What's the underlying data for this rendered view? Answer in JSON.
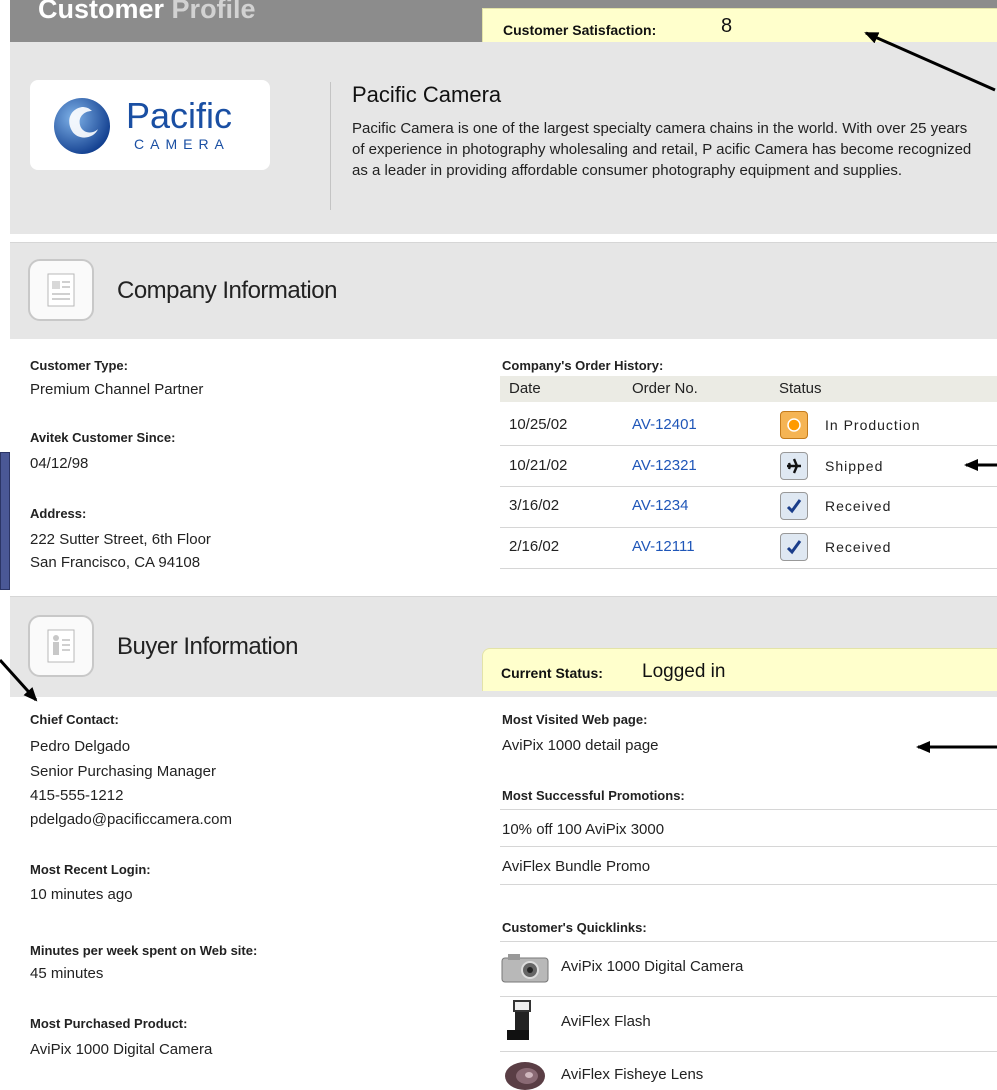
{
  "header": {
    "title_part1": "Customer",
    "title_part2": "Profile",
    "satisfaction_label": "Customer Satisfaction:",
    "satisfaction_value": "8"
  },
  "profile": {
    "logo_name": "Pacific",
    "logo_sub": "CAMERA",
    "company_name": "Pacific Camera",
    "description": "Pacific Camera is one of the largest specialty camera chains in the world. With over 25 years of experience in photography wholesaling and retail, P acific Camera has become recognized as a leader in providing affordable consumer photography equipment and supplies."
  },
  "company_section": {
    "title": "Company Information",
    "customer_type_label": "Customer Type:",
    "customer_type": "Premium Channel Partner",
    "since_label": "Avitek Customer Since:",
    "since": "04/12/98",
    "address_label": "Address:",
    "address_line1": "222 Sutter Street, 6th Floor",
    "address_line2": "San Francisco, CA  94108"
  },
  "order_history": {
    "title": "Company's Order History:",
    "headers": {
      "date": "Date",
      "order_no": "Order No.",
      "status": "Status"
    },
    "rows": [
      {
        "date": "10/25/02",
        "order_no": "AV-12401",
        "status": "In Production",
        "icon": "in-production-icon"
      },
      {
        "date": "10/21/02",
        "order_no": "AV-12321",
        "status": "Shipped",
        "icon": "airplane-icon"
      },
      {
        "date": "3/16/02",
        "order_no": "AV-1234",
        "status": "Received",
        "icon": "checkmark-icon"
      },
      {
        "date": "2/16/02",
        "order_no": "AV-12111",
        "status": "Received",
        "icon": "checkmark-icon"
      }
    ]
  },
  "buyer_section": {
    "title": "Buyer Information",
    "current_status_label": "Current Status:",
    "current_status": "Logged in",
    "chief_contact_label": "Chief Contact:",
    "contact_name": "Pedro Delgado",
    "contact_title": "Senior Purchasing Manager",
    "contact_phone": "415-555-1212",
    "contact_email": "pdelgado@pacificcamera.com",
    "recent_login_label": "Most Recent Login:",
    "recent_login": "10 minutes ago",
    "minutes_label": "Minutes per week spent on Web site:",
    "minutes": "45 minutes",
    "most_purchased_label": "Most Purchased Product:",
    "most_purchased": "AviPix 1000 Digital Camera",
    "visited_label": "Most Visited Web page:",
    "visited": "AviPix 1000 detail page",
    "promotions_label": "Most Successful Promotions:",
    "promotions": [
      "10% off 100 AviPix 3000",
      "AviFlex Bundle Promo"
    ],
    "quicklinks_label": "Customer's Quicklinks:",
    "quicklinks": [
      {
        "label": "AviPix 1000 Digital Camera",
        "icon": "digital-camera-icon"
      },
      {
        "label": "AviFlex Flash",
        "icon": "camera-flash-icon"
      },
      {
        "label": "AviFlex Fisheye Lens",
        "icon": "fisheye-lens-icon"
      }
    ]
  },
  "colors": {
    "link": "#1f56b8",
    "highlight": "#ffffcc",
    "header": "#8c8c8c",
    "panel": "#e6e6e6"
  }
}
